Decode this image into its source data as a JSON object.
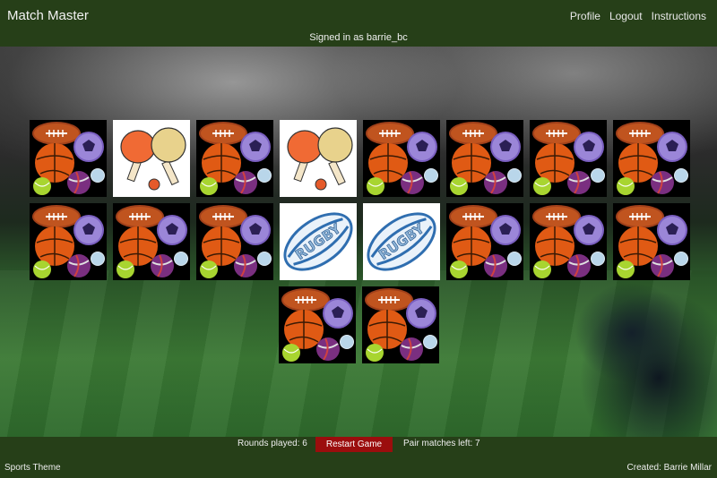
{
  "header": {
    "brand": "Match Master",
    "links": [
      "Profile",
      "Logout",
      "Instructions"
    ],
    "signed_in": "Signed in as barrie_bc"
  },
  "board": {
    "columns": 8,
    "cards": [
      {
        "face": "down"
      },
      {
        "face": "up",
        "icon": "ping-pong"
      },
      {
        "face": "down"
      },
      {
        "face": "up",
        "icon": "ping-pong"
      },
      {
        "face": "down"
      },
      {
        "face": "down"
      },
      {
        "face": "down"
      },
      {
        "face": "down"
      },
      {
        "face": "down"
      },
      {
        "face": "down"
      },
      {
        "face": "down"
      },
      {
        "face": "up",
        "icon": "rugby-ball"
      },
      {
        "face": "up",
        "icon": "rugby-ball"
      },
      {
        "face": "down"
      },
      {
        "face": "down"
      },
      {
        "face": "down"
      },
      {
        "face": "down"
      },
      {
        "face": "down"
      }
    ],
    "rugby_text": "RUGBY"
  },
  "status": {
    "rounds": "Rounds played: 6",
    "restart": "Restart Game",
    "pairs": "Pair matches left: 7"
  },
  "footer": {
    "theme": "Sports Theme",
    "credit": "Created: Barrie Millar"
  },
  "colors": {
    "bar": "#263f18",
    "restart": "#9b0d0d"
  }
}
